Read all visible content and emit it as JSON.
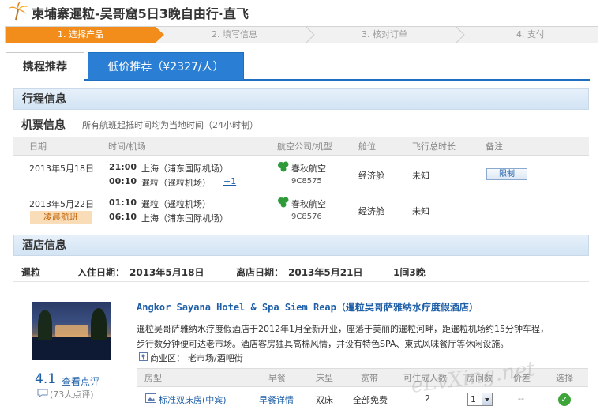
{
  "page": {
    "title": "柬埔寨暹粒-吴哥窟5日3晚自由行·直飞"
  },
  "steps": [
    "1. 选择产品",
    "2. 填写信息",
    "3. 核对订单",
    "4. 支付"
  ],
  "tabs": {
    "recommend": "携程推荐",
    "low_price": "低价推荐（¥2327/人）"
  },
  "itinerary": {
    "section_title": "行程信息",
    "flight_title": "机票信息",
    "flight_note": "所有航班起抵时间均为当地时间（24小时制）",
    "headers": [
      "日期",
      "时间/机场",
      "航空公司/机型",
      "舱位",
      "飞行总时长",
      "备注"
    ],
    "outbound": {
      "date": "2013年5月18日",
      "dep_time": "21:00",
      "dep_airport": "上海（浦东国际机场）",
      "arr_time": "00:10",
      "arr_airport": "暹粒（暹粒机场）",
      "plus_day": "+1",
      "airline": "春秋航空",
      "flight_no": "9C8575",
      "cabin": "经济舱",
      "duration": "未知",
      "remark_button": "限制"
    },
    "return": {
      "date": "2013年5月22日",
      "badge": "凌晨航班",
      "dep_time": "01:10",
      "dep_airport": "暹粒（暹粒机场）",
      "arr_time": "06:10",
      "arr_airport": "上海（浦东国际机场）",
      "airline": "春秋航空",
      "flight_no": "9C8576",
      "cabin": "经济舱",
      "duration": "未知"
    }
  },
  "hotel": {
    "section_title": "酒店信息",
    "city": "暹粒",
    "checkin_label": "入住日期：",
    "checkin": "2013年5月18日",
    "checkout_label": "离店日期：",
    "checkout": "2013年5月21日",
    "rooms_nights": "1间3晚",
    "name": "Angkor Sayana Hotel & Spa Siem Reap（暹粒吴哥萨雅纳水疗度假酒店）",
    "desc1": "暹粒吴哥萨雅纳水疗度假酒店于2012年1月全新开业，座落于美丽的暹粒河畔，距暹粒机场约15分钟车程，",
    "desc2": "步行数分钟便可达老市场。酒店客房独具高棉风情，并设有特色SPA、柬式风味餐厅等休闲设施。",
    "area_label": "商业区：",
    "area": "老市场/酒吧街",
    "score": "4.1",
    "review_link": "查看点评",
    "review_count": "(73人点评)",
    "room_headers": [
      "房型",
      "早餐",
      "床型",
      "宽带",
      "可住成人数",
      "房间数",
      "价差",
      "选择"
    ],
    "room": {
      "type": "标准双床房(中宾)",
      "breakfast": "早餐详情",
      "bed": "双床",
      "internet": "全部免费",
      "adults": "2",
      "count": "1",
      "diff": "--"
    }
  },
  "watermark": "eLvXing.net",
  "colors": {
    "accent": "#f28c1a",
    "brand_blue": "#2a7fd4",
    "link": "#1e5fa8"
  }
}
